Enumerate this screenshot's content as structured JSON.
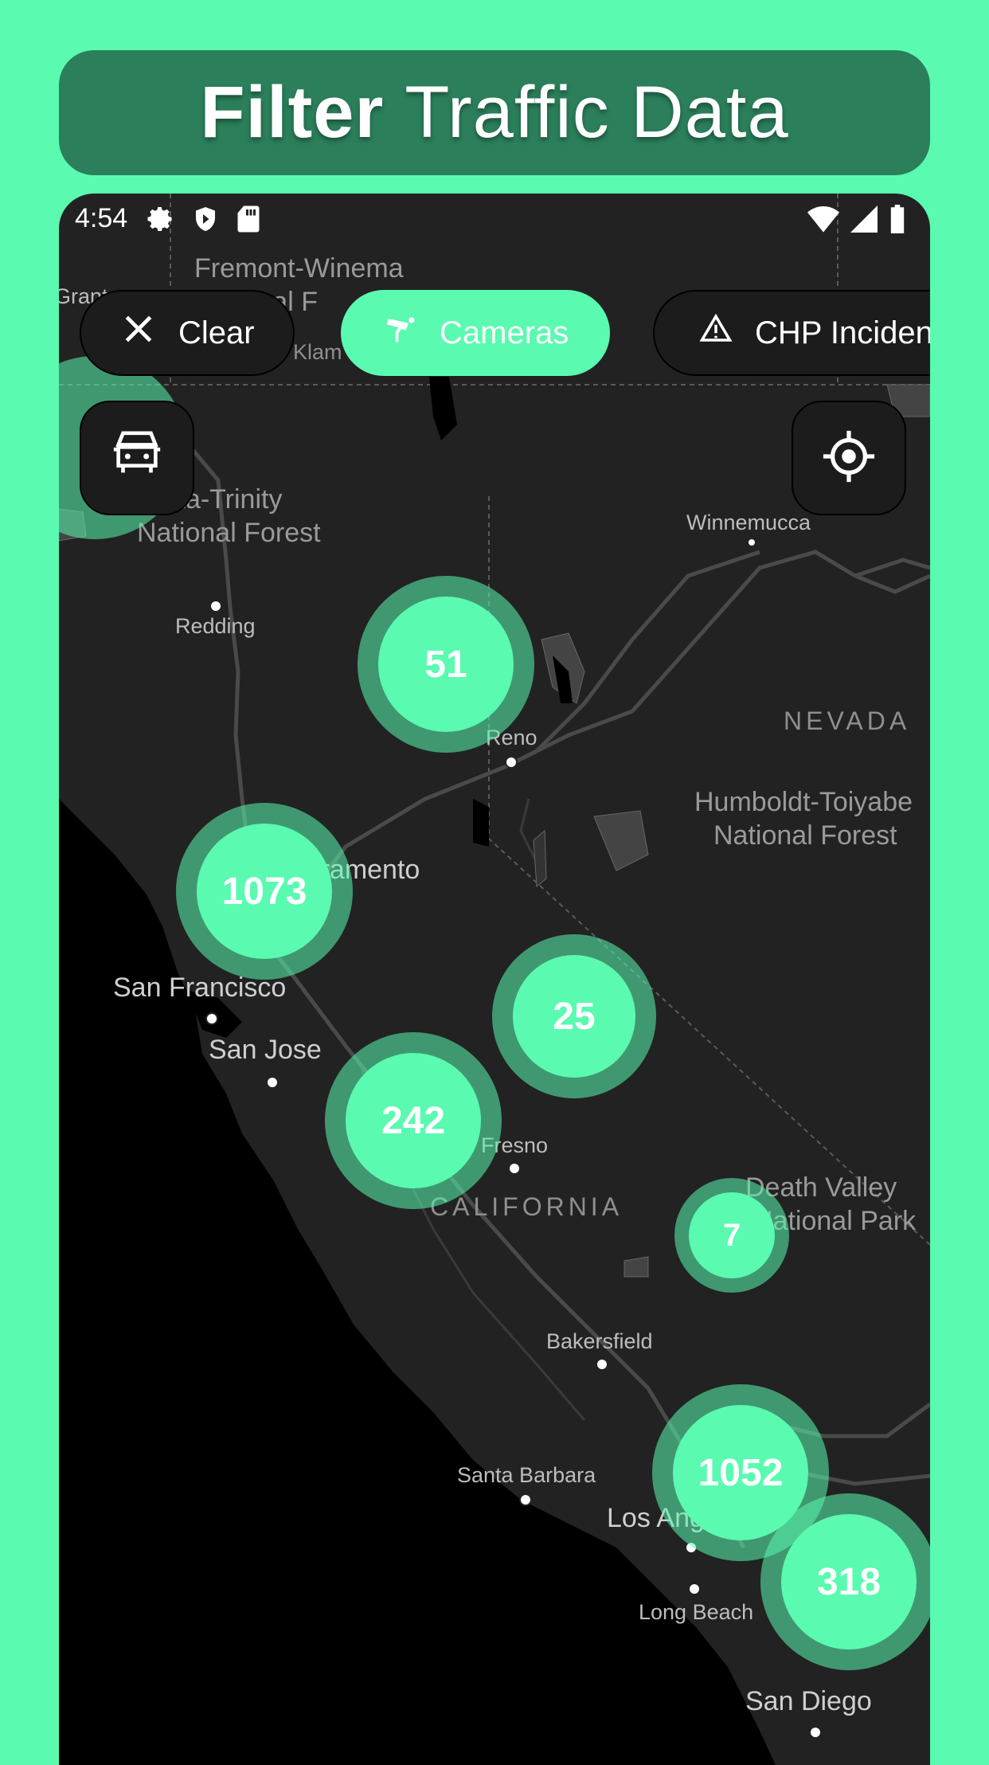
{
  "banner": {
    "bold": "Filter",
    "light": "Traffic Data"
  },
  "status": {
    "time": "4:54",
    "left_icons": [
      "settings-icon",
      "shield-icon",
      "sd-card-icon"
    ],
    "right_icons": [
      "wifi-icon",
      "signal-icon",
      "battery-icon"
    ]
  },
  "filters": {
    "clear_label": "Clear",
    "cameras_label": "Cameras",
    "chp_label": "CHP Incidents"
  },
  "fabs": {
    "traffic": "traffic-car-icon",
    "locate": "my-location-icon"
  },
  "colors": {
    "accent": "#5afab0",
    "banner": "#2b7f5b",
    "map": "#222222"
  },
  "map_labels": {
    "fremont": "Fremont-Winema",
    "fremont_line2": "National F",
    "grant": "Grant",
    "klamath": "Klam",
    "shasta_line1": "Shasta-Trinity",
    "shasta_line2": "National Forest",
    "redding": "Redding",
    "winnemucca": "Winnemucca",
    "nevada": "NEVADA",
    "reno": "Reno",
    "humboldt_line1": "Humboldt-Toiyabe",
    "humboldt_line2": "National Forest",
    "sacramento": "Sacramento",
    "san_francisco": "San Francisco",
    "san_jose": "San Jose",
    "fresno": "Fresno",
    "california": "CALIFORNIA",
    "death_valley_line1": "Death Valley",
    "death_valley_line2": "National Park",
    "bakersfield": "Bakersfield",
    "santa_barbara": "Santa Barbara",
    "los_angeles": "Los Angeles",
    "long_beach": "Long Beach",
    "san_diego": "San Diego"
  },
  "clusters": [
    {
      "id": "c51",
      "count": "51"
    },
    {
      "id": "c1073",
      "count": "1073"
    },
    {
      "id": "c25",
      "count": "25"
    },
    {
      "id": "c242",
      "count": "242"
    },
    {
      "id": "c7",
      "count": "7"
    },
    {
      "id": "c1052",
      "count": "1052"
    },
    {
      "id": "c318",
      "count": "318"
    }
  ]
}
